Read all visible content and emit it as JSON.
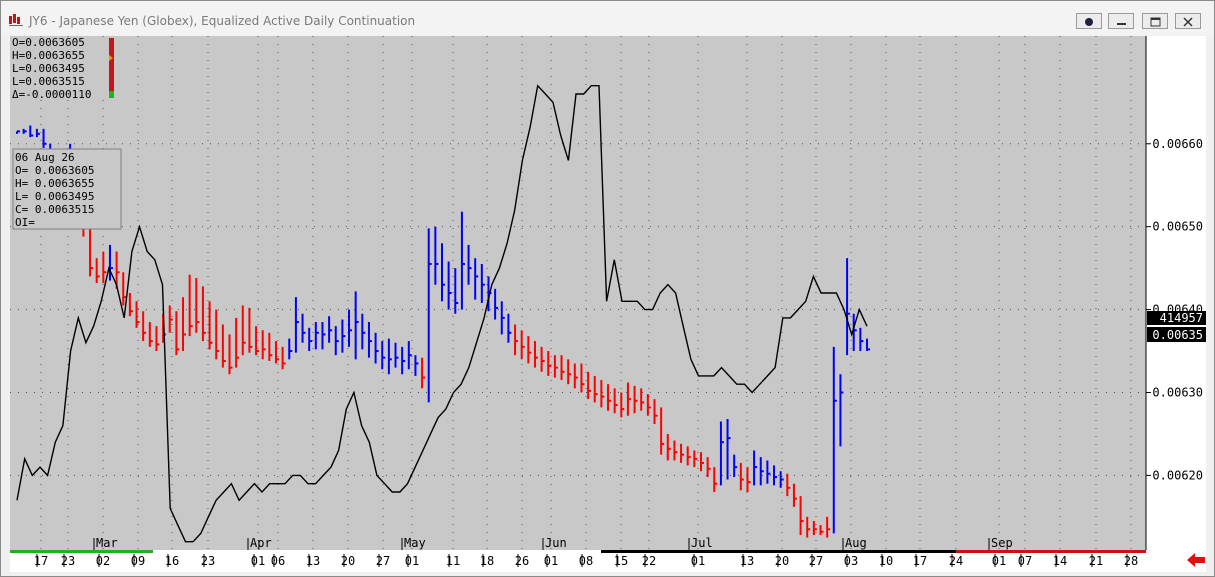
{
  "window": {
    "title": "JY6 - Japanese Yen (Globex), Equalized Active Daily Continuation"
  },
  "ohlc_readout": [
    "O=0.0063605",
    "H=0.0063655",
    "L=0.0063495",
    "L=0.0063515",
    "Δ=-0.0000110"
  ],
  "tooltip": [
    "06 Aug 26",
    "O=   0.0063605",
    "H=   0.0063655",
    "L=   0.0063495",
    "C=   0.0063515",
    "OI="
  ],
  "price_labels": {
    "volume": "414957",
    "last": "0.00635"
  },
  "chart_data": {
    "type": "bar",
    "title": "JY6 - Japanese Yen (Globex), Equalized Active Daily Continuation",
    "y_axis": {
      "range": [
        0.00611,
        0.00673
      ],
      "ticks": [
        "0.00620",
        "0.00630",
        "0.00640",
        "0.00650",
        "0.00660"
      ],
      "position": "right"
    },
    "x_axis": {
      "months": [
        "Mar",
        "Apr",
        "May",
        "Jun",
        "Jul",
        "Aug",
        "Sep"
      ],
      "day_labels": [
        "17",
        "23",
        "02",
        "09",
        "16",
        "23",
        "01",
        "06",
        "13",
        "20",
        "27",
        "01",
        "11",
        "18",
        "26",
        "01",
        "08",
        "15",
        "22",
        "01",
        "13",
        "20",
        "27",
        "03",
        "10",
        "17",
        "24",
        "01",
        "07",
        "14",
        "21",
        "28"
      ]
    },
    "grid": true,
    "series": [
      {
        "type": "ohlc-bars",
        "colors": {
          "up": "#0000ff",
          "down": "#ff0000"
        },
        "bars": [
          [
            0.006615,
            0.006612,
            0.006615,
            "b"
          ],
          [
            0.006618,
            0.006612,
            0.006615,
            "b"
          ],
          [
            0.006622,
            0.006608,
            0.00661,
            "b"
          ],
          [
            0.006618,
            0.006608,
            0.006612,
            "b"
          ],
          [
            0.006618,
            0.006595,
            0.0066,
            "b"
          ],
          [
            0.0066,
            0.00658,
            0.006585,
            "b"
          ],
          [
            0.006585,
            0.006562,
            0.00657,
            "b"
          ],
          [
            0.006585,
            0.006568,
            0.006578,
            "b"
          ],
          [
            0.0066,
            0.00657,
            0.00659,
            "b"
          ],
          [
            0.006592,
            0.006552,
            0.00656,
            "r"
          ],
          [
            0.00657,
            0.006488,
            0.0065,
            "r"
          ],
          [
            0.006505,
            0.00644,
            0.00645,
            "r"
          ],
          [
            0.006462,
            0.006432,
            0.00644,
            "r"
          ],
          [
            0.00647,
            0.006432,
            0.006445,
            "r"
          ],
          [
            0.006478,
            0.006435,
            0.00645,
            "b"
          ],
          [
            0.00647,
            0.006425,
            0.006445,
            "r"
          ],
          [
            0.006445,
            0.006405,
            0.006415,
            "r"
          ],
          [
            0.00642,
            0.006392,
            0.006398,
            "r"
          ],
          [
            0.00641,
            0.006378,
            0.006385,
            "r"
          ],
          [
            0.006398,
            0.006362,
            0.006372,
            "r"
          ],
          [
            0.006385,
            0.006355,
            0.006362,
            "r"
          ],
          [
            0.00638,
            0.00635,
            0.006358,
            "r"
          ],
          [
            0.006395,
            0.00636,
            0.00637,
            "r"
          ],
          [
            0.006405,
            0.006372,
            0.006388,
            "r"
          ],
          [
            0.006398,
            0.006345,
            0.006352,
            "r"
          ],
          [
            0.006415,
            0.00635,
            0.00637,
            "r"
          ],
          [
            0.006442,
            0.006368,
            0.00638,
            "r"
          ],
          [
            0.006438,
            0.006372,
            0.006385,
            "r"
          ],
          [
            0.006428,
            0.006362,
            0.006372,
            "r"
          ],
          [
            0.00641,
            0.006352,
            0.00636,
            "r"
          ],
          [
            0.0064,
            0.00634,
            0.00635,
            "r"
          ],
          [
            0.006382,
            0.00633,
            0.006338,
            "r"
          ],
          [
            0.00637,
            0.006322,
            0.00633,
            "r"
          ],
          [
            0.00639,
            0.00633,
            0.006342,
            "r"
          ],
          [
            0.006405,
            0.006345,
            0.00636,
            "r"
          ],
          [
            0.006402,
            0.006348,
            0.006355,
            "r"
          ],
          [
            0.00638,
            0.006345,
            0.00635,
            "r"
          ],
          [
            0.006375,
            0.00634,
            0.006352,
            "r"
          ],
          [
            0.006372,
            0.006338,
            0.006345,
            "r"
          ],
          [
            0.006362,
            0.006335,
            0.00634,
            "r"
          ],
          [
            0.006355,
            0.006328,
            0.006335,
            "r"
          ],
          [
            0.006365,
            0.00634,
            0.00635,
            "b"
          ],
          [
            0.006415,
            0.006348,
            0.006385,
            "b"
          ],
          [
            0.006395,
            0.00636,
            0.006372,
            "b"
          ],
          [
            0.006378,
            0.00635,
            0.006362,
            "b"
          ],
          [
            0.006385,
            0.006352,
            0.006372,
            "b"
          ],
          [
            0.006385,
            0.006352,
            0.00637,
            "b"
          ],
          [
            0.006392,
            0.00636,
            0.006375,
            "b"
          ],
          [
            0.00638,
            0.006345,
            0.006362,
            "b"
          ],
          [
            0.006388,
            0.006348,
            0.006368,
            "b"
          ],
          [
            0.0064,
            0.006355,
            0.006375,
            "b"
          ],
          [
            0.006422,
            0.00634,
            0.006385,
            "b"
          ],
          [
            0.006395,
            0.006352,
            0.006372,
            "b"
          ],
          [
            0.006385,
            0.006342,
            0.006362,
            "b"
          ],
          [
            0.006372,
            0.006335,
            0.00635,
            "b"
          ],
          [
            0.006362,
            0.006328,
            0.006342,
            "b"
          ],
          [
            0.006365,
            0.006322,
            0.00634,
            "b"
          ],
          [
            0.00636,
            0.00633,
            0.006342,
            "b"
          ],
          [
            0.006355,
            0.006322,
            0.006338,
            "b"
          ],
          [
            0.006362,
            0.006328,
            0.006345,
            "b"
          ],
          [
            0.006345,
            0.00632,
            0.006335,
            "b"
          ],
          [
            0.006342,
            0.006305,
            0.006318,
            "r"
          ],
          [
            0.006498,
            0.006288,
            0.006455,
            "b"
          ],
          [
            0.0065,
            0.00643,
            0.006455,
            "b"
          ],
          [
            0.00648,
            0.00641,
            0.00643,
            "b"
          ],
          [
            0.006458,
            0.0064,
            0.00642,
            "b"
          ],
          [
            0.00645,
            0.006395,
            0.006408,
            "b"
          ],
          [
            0.006518,
            0.0064,
            0.006455,
            "b"
          ],
          [
            0.006478,
            0.00643,
            0.00645,
            "b"
          ],
          [
            0.006462,
            0.006412,
            0.00644,
            "b"
          ],
          [
            0.006455,
            0.006408,
            0.00643,
            "b"
          ],
          [
            0.00644,
            0.006398,
            0.00642,
            "b"
          ],
          [
            0.006425,
            0.006388,
            0.006402,
            "b"
          ],
          [
            0.00641,
            0.00637,
            0.00639,
            "b"
          ],
          [
            0.006395,
            0.00636,
            0.006372,
            "b"
          ],
          [
            0.006382,
            0.006345,
            0.006362,
            "r"
          ],
          [
            0.006375,
            0.00634,
            0.006355,
            "r"
          ],
          [
            0.006368,
            0.006335,
            0.006348,
            "r"
          ],
          [
            0.006362,
            0.00633,
            0.006342,
            "r"
          ],
          [
            0.006355,
            0.006325,
            0.006338,
            "r"
          ],
          [
            0.00635,
            0.00632,
            0.006332,
            "r"
          ],
          [
            0.006345,
            0.006318,
            0.00633,
            "r"
          ],
          [
            0.006345,
            0.006315,
            0.006325,
            "r"
          ],
          [
            0.00634,
            0.00631,
            0.006322,
            "r"
          ],
          [
            0.006335,
            0.006305,
            0.006318,
            "r"
          ],
          [
            0.006335,
            0.0063,
            0.00631,
            "r"
          ],
          [
            0.006325,
            0.006292,
            0.006302,
            "r"
          ],
          [
            0.00632,
            0.006288,
            0.006298,
            "r"
          ],
          [
            0.006315,
            0.006282,
            0.006295,
            "r"
          ],
          [
            0.00631,
            0.006278,
            0.00629,
            "r"
          ],
          [
            0.006305,
            0.006275,
            0.006285,
            "r"
          ],
          [
            0.0063,
            0.00627,
            0.00628,
            "r"
          ],
          [
            0.006312,
            0.006272,
            0.006292,
            "r"
          ],
          [
            0.006308,
            0.006275,
            0.00629,
            "r"
          ],
          [
            0.006305,
            0.006278,
            0.006288,
            "r"
          ],
          [
            0.006298,
            0.006272,
            0.006282,
            "r"
          ],
          [
            0.006292,
            0.006262,
            0.006272,
            "r"
          ],
          [
            0.006282,
            0.006225,
            0.006238,
            "r"
          ],
          [
            0.00625,
            0.006218,
            0.006232,
            "r"
          ],
          [
            0.006242,
            0.006218,
            0.006228,
            "r"
          ],
          [
            0.006238,
            0.006215,
            0.006225,
            "r"
          ],
          [
            0.006235,
            0.006212,
            0.006222,
            "r"
          ],
          [
            0.00623,
            0.00621,
            0.00622,
            "r"
          ],
          [
            0.006228,
            0.006205,
            0.006215,
            "r"
          ],
          [
            0.006222,
            0.006198,
            0.006208,
            "r"
          ],
          [
            0.00621,
            0.00618,
            0.00619,
            "r"
          ],
          [
            0.006265,
            0.006188,
            0.00624,
            "b"
          ],
          [
            0.006268,
            0.006195,
            0.006245,
            "b"
          ],
          [
            0.006225,
            0.006198,
            0.00621,
            "b"
          ],
          [
            0.006215,
            0.006182,
            0.006195,
            "r"
          ],
          [
            0.00621,
            0.00618,
            0.006192,
            "r"
          ],
          [
            0.00623,
            0.006188,
            0.00621,
            "b"
          ],
          [
            0.006222,
            0.006188,
            0.006205,
            "b"
          ],
          [
            0.006218,
            0.00619,
            0.006202,
            "b"
          ],
          [
            0.006212,
            0.006188,
            0.006198,
            "b"
          ],
          [
            0.006205,
            0.006185,
            0.006195,
            "b"
          ],
          [
            0.006202,
            0.006175,
            0.006185,
            "r"
          ],
          [
            0.00619,
            0.006162,
            0.006172,
            "r"
          ],
          [
            0.006175,
            0.006128,
            0.006145,
            "r"
          ],
          [
            0.00615,
            0.006125,
            0.006135,
            "r"
          ],
          [
            0.006145,
            0.006128,
            0.006135,
            "r"
          ],
          [
            0.00614,
            0.006128,
            0.006132,
            "r"
          ],
          [
            0.00615,
            0.006125,
            0.006135,
            "r"
          ],
          [
            0.006355,
            0.00613,
            0.00629,
            "b"
          ],
          [
            0.006322,
            0.006235,
            0.0063,
            "b"
          ],
          [
            0.006462,
            0.006345,
            0.006395,
            "b"
          ],
          [
            0.006395,
            0.00635,
            0.006375,
            "b"
          ],
          [
            0.006378,
            0.00635,
            0.006362,
            "b"
          ],
          [
            0.006365,
            0.00635,
            0.006352,
            "b"
          ]
        ]
      },
      {
        "type": "line",
        "color": "#000000",
        "values": [
          0.00617,
          0.00622,
          0.0062,
          0.00621,
          0.0062,
          0.00624,
          0.00626,
          0.00635,
          0.00639,
          0.00636,
          0.00638,
          0.00641,
          0.00645,
          0.00643,
          0.00639,
          0.00647,
          0.0065,
          0.00647,
          0.00646,
          0.00643,
          0.00616,
          0.00614,
          0.00612,
          0.00612,
          0.00613,
          0.00615,
          0.00617,
          0.00618,
          0.00619,
          0.00617,
          0.00618,
          0.00619,
          0.00618,
          0.00619,
          0.00619,
          0.00619,
          0.0062,
          0.0062,
          0.00619,
          0.00619,
          0.0062,
          0.00621,
          0.00623,
          0.00628,
          0.0063,
          0.00626,
          0.00624,
          0.0062,
          0.00619,
          0.00618,
          0.00618,
          0.00619,
          0.00621,
          0.00623,
          0.00625,
          0.00627,
          0.00628,
          0.0063,
          0.00631,
          0.00633,
          0.00636,
          0.00639,
          0.00643,
          0.00645,
          0.00648,
          0.00652,
          0.00658,
          0.00662,
          0.00667,
          0.00666,
          0.00665,
          0.00661,
          0.00658,
          0.00666,
          0.00666,
          0.00667,
          0.00667,
          0.00641,
          0.00646,
          0.00641,
          0.00641,
          0.00641,
          0.0064,
          0.0064,
          0.00642,
          0.00643,
          0.00642,
          0.00638,
          0.00634,
          0.00632,
          0.00632,
          0.00632,
          0.00633,
          0.00632,
          0.00631,
          0.00631,
          0.0063,
          0.00631,
          0.00632,
          0.00633,
          0.00639,
          0.00639,
          0.0064,
          0.00641,
          0.00644,
          0.00642,
          0.00642,
          0.00642,
          0.0064,
          0.00637,
          0.0064,
          0.00638
        ]
      }
    ]
  }
}
